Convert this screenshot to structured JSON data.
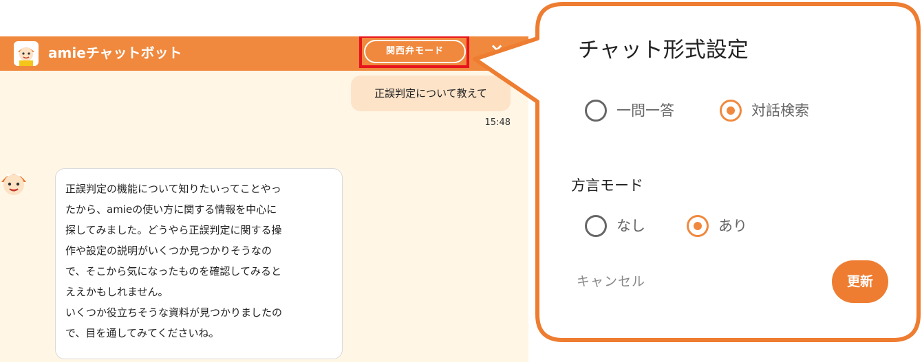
{
  "chat": {
    "title": "amieチャットボット",
    "mode_button": "関西弁モード",
    "close_glyph": "×",
    "user_message": "正誤判定について教えて",
    "timestamp": "15:48",
    "bot_lines": [
      "正誤判定の機能について知りたいってことやっ",
      "たから、amieの使い方に関する情報を中心に",
      "探してみました。どうやら正誤判定に関する操",
      "作や設定の説明がいくつか見つかりそうなの",
      "で、そこから気になったものを確認してみると",
      "ええかもしれません。",
      "いくつか役立ちそうな資料が見つかりましたの",
      "で、目を通してみてくださいね。"
    ]
  },
  "panel": {
    "title": "チャット形式設定",
    "format_options": [
      {
        "label": "一問一答",
        "selected": false
      },
      {
        "label": "対話検索",
        "selected": true
      }
    ],
    "dialect_label": "方言モード",
    "dialect_options": [
      {
        "label": "なし",
        "selected": false
      },
      {
        "label": "あり",
        "selected": true
      }
    ],
    "cancel": "キャンセル",
    "update": "更新"
  },
  "colors": {
    "accent": "#f0893e",
    "chat_background": "#fff6e6",
    "user_bubble": "#fde3c8",
    "highlight_red": "#e8141d"
  },
  "icons": {
    "header_avatar": "mascot-avatar-icon",
    "bot_avatar": "mascot-avatar-icon",
    "close": "close-icon"
  }
}
